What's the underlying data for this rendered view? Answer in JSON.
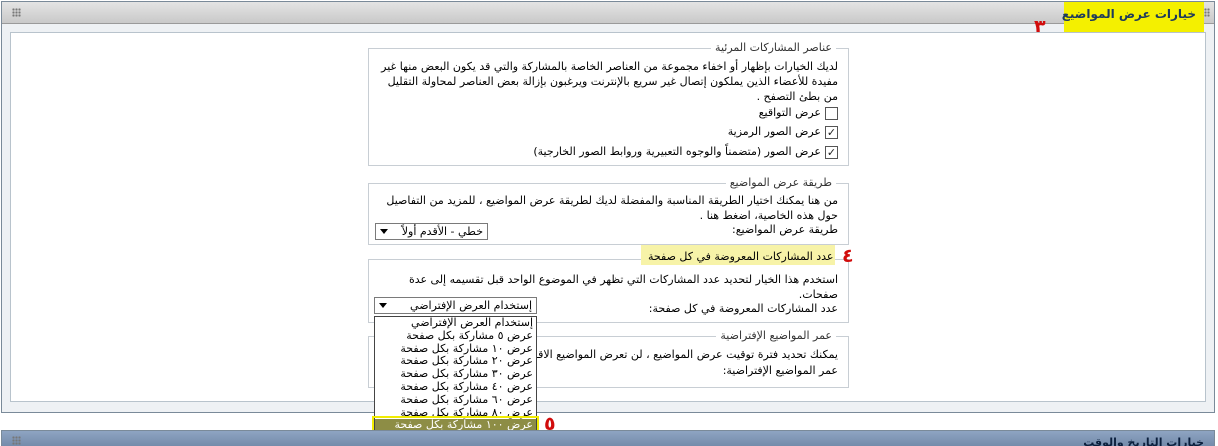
{
  "section": {
    "title": "خيارات عرض المواضيع",
    "step_marker": "٣"
  },
  "visible_elements": {
    "legend": "عناصر المشاركات المرئية",
    "description": "لديك الخيارات بإظهار أو اخفاء مجموعة من العناصر الخاصة بالمشاركة والتي قد يكون البعض منها غير مفيدة للأعضاء الذين يملكون إتصال غير سريع بالإنترنت ويرغبون بإزالة بعض العناصر لمحاولة التقليل من بطئ التصفح .",
    "options": [
      {
        "label": "عرض التواقيع",
        "checked": false
      },
      {
        "label": "عرض الصور الرمزية",
        "checked": true
      },
      {
        "label": "عرض الصور (متضمناً والوجوه التعبيرية وروابط الصور الخارجية)",
        "checked": true
      }
    ]
  },
  "display_mode": {
    "legend": "طريقة عرض المواضيع",
    "description": "من هنا يمكنك اختيار الطريقة المناسبة والمفضلة لديك لطريقة عرض المواضيع ، للمزيد من التفاصيل حول هذه الخاصية، اضغط هنا .",
    "field_label": "طريقة عرض المواضيع:",
    "selected": "خطي - الأقدم أولاً"
  },
  "posts_per_page": {
    "legend": "عدد المشاركات المعروضة في كل صفحة",
    "step_marker": "٤",
    "description": "استخدم هذا الخيار لتحديد عدد المشاركات التي تظهر في الموضوع الواحد قبل تقسيمه إلى عدة صفحات.",
    "field_label": "عدد المشاركات المعروضة في كل صفحة:",
    "selected": "إستخدام العرض الإفتراضي",
    "options": [
      "إستخدام العرض الإفتراضي",
      "عرض ٥ مشاركة بكل صفحة",
      "عرض ١٠ مشاركة بكل صفحة",
      "عرض ٢٠ مشاركة بكل صفحة",
      "عرض ٣٠ مشاركة بكل صفحة",
      "عرض ٤٠ مشاركة بكل صفحة",
      "عرض ٦٠ مشاركة بكل صفحة",
      "عرض ٨٠ مشاركة بكل صفحة",
      "عرض ١٠٠ مشاركة بكل صفحة"
    ],
    "highlighted_option_index": 8,
    "highlight_marker": "٥"
  },
  "thread_age": {
    "legend": "عمر المواضيع الإفتراضية",
    "description": "يمكنك تحديد فترة توقيت عرض المواضيع ، لن تعرض المواضيع الاقدم",
    "field_label": "عمر المواضيع الإفتراضية:"
  },
  "next_section": {
    "title": "خيارات التاريخ والوقت"
  },
  "colors": {
    "highlight_yellow": "#f4f000",
    "marker_red": "#d10c0c",
    "dropdown_selected": "#8d8d45"
  }
}
